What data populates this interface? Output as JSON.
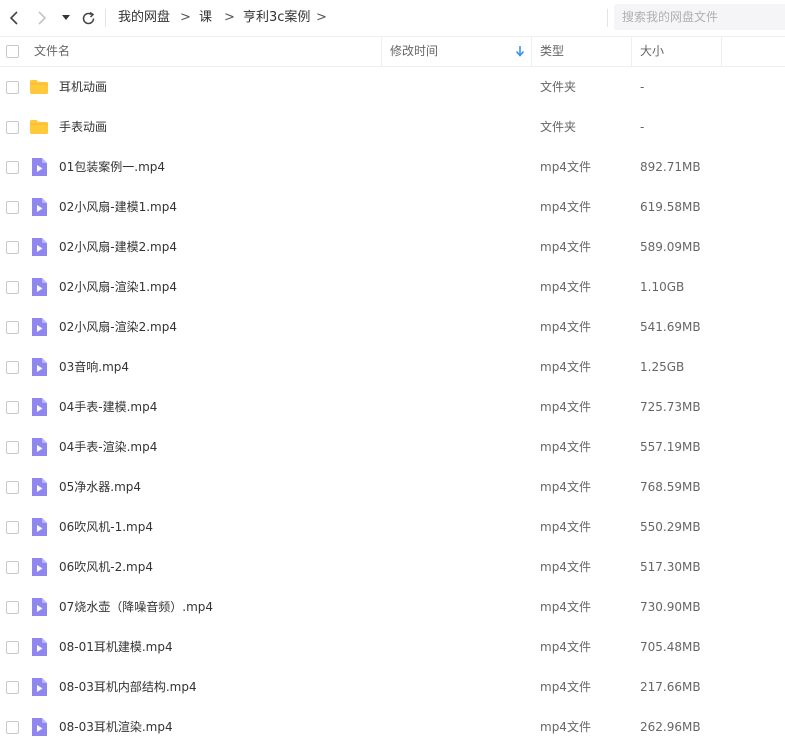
{
  "breadcrumb": {
    "items": [
      "我的网盘",
      "课",
      "亨利3c案例"
    ],
    "separator": ">"
  },
  "search": {
    "placeholder": "搜索我的网盘文件"
  },
  "columns": {
    "name": "文件名",
    "modified": "修改时间",
    "type": "类型",
    "size": "大小"
  },
  "sort": {
    "column": "modified",
    "direction": "down",
    "accent": "#2e8cf0"
  },
  "colors": {
    "folder": "#ffc93c",
    "video": "#8f87ee"
  },
  "files": [
    {
      "name": "耳机动画",
      "type": "文件夹",
      "size": "-",
      "icon": "folder-icon"
    },
    {
      "name": "手表动画",
      "type": "文件夹",
      "size": "-",
      "icon": "folder-icon"
    },
    {
      "name": "01包装案例一.mp4",
      "type": "mp4文件",
      "size": "892.71MB",
      "icon": "video-file-icon"
    },
    {
      "name": "02小风扇-建模1.mp4",
      "type": "mp4文件",
      "size": "619.58MB",
      "icon": "video-file-icon"
    },
    {
      "name": "02小风扇-建模2.mp4",
      "type": "mp4文件",
      "size": "589.09MB",
      "icon": "video-file-icon"
    },
    {
      "name": "02小风扇-渲染1.mp4",
      "type": "mp4文件",
      "size": "1.10GB",
      "icon": "video-file-icon"
    },
    {
      "name": "02小风扇-渲染2.mp4",
      "type": "mp4文件",
      "size": "541.69MB",
      "icon": "video-file-icon"
    },
    {
      "name": "03音响.mp4",
      "type": "mp4文件",
      "size": "1.25GB",
      "icon": "video-file-icon"
    },
    {
      "name": "04手表-建模.mp4",
      "type": "mp4文件",
      "size": "725.73MB",
      "icon": "video-file-icon"
    },
    {
      "name": "04手表-渲染.mp4",
      "type": "mp4文件",
      "size": "557.19MB",
      "icon": "video-file-icon"
    },
    {
      "name": "05净水器.mp4",
      "type": "mp4文件",
      "size": "768.59MB",
      "icon": "video-file-icon"
    },
    {
      "name": "06吹风机-1.mp4",
      "type": "mp4文件",
      "size": "550.29MB",
      "icon": "video-file-icon"
    },
    {
      "name": "06吹风机-2.mp4",
      "type": "mp4文件",
      "size": "517.30MB",
      "icon": "video-file-icon"
    },
    {
      "name": "07烧水壶（降噪音频）.mp4",
      "type": "mp4文件",
      "size": "730.90MB",
      "icon": "video-file-icon"
    },
    {
      "name": "08-01耳机建模.mp4",
      "type": "mp4文件",
      "size": "705.48MB",
      "icon": "video-file-icon"
    },
    {
      "name": "08-03耳机内部结构.mp4",
      "type": "mp4文件",
      "size": "217.66MB",
      "icon": "video-file-icon"
    },
    {
      "name": "08-03耳机渲染.mp4",
      "type": "mp4文件",
      "size": "262.96MB",
      "icon": "video-file-icon"
    }
  ]
}
